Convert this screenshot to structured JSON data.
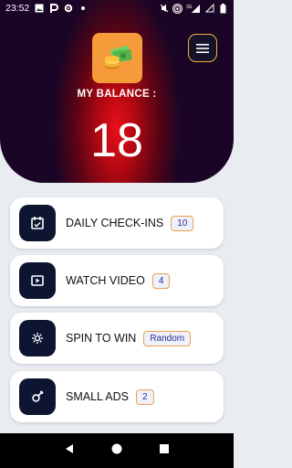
{
  "status": {
    "time": "23:52",
    "network": "3G"
  },
  "header": {
    "balance_label": "MY BALANCE :",
    "balance_value": "18"
  },
  "colors": {
    "accent": "#f0a04b",
    "card_icon_bg": "#0d1530",
    "badge_text": "#2a2f8f",
    "header_red": "#e8101a"
  },
  "tasks": [
    {
      "label": "DAILY CHECK-INS",
      "badge": "10",
      "icon": "calendar-icon"
    },
    {
      "label": "WATCH VIDEO",
      "badge": "4",
      "icon": "play-video-icon"
    },
    {
      "label": "SPIN TO WIN",
      "badge": "Random",
      "icon": "spin-icon"
    },
    {
      "label": "SMALL ADS",
      "badge": "2",
      "icon": "ad-icon"
    }
  ]
}
